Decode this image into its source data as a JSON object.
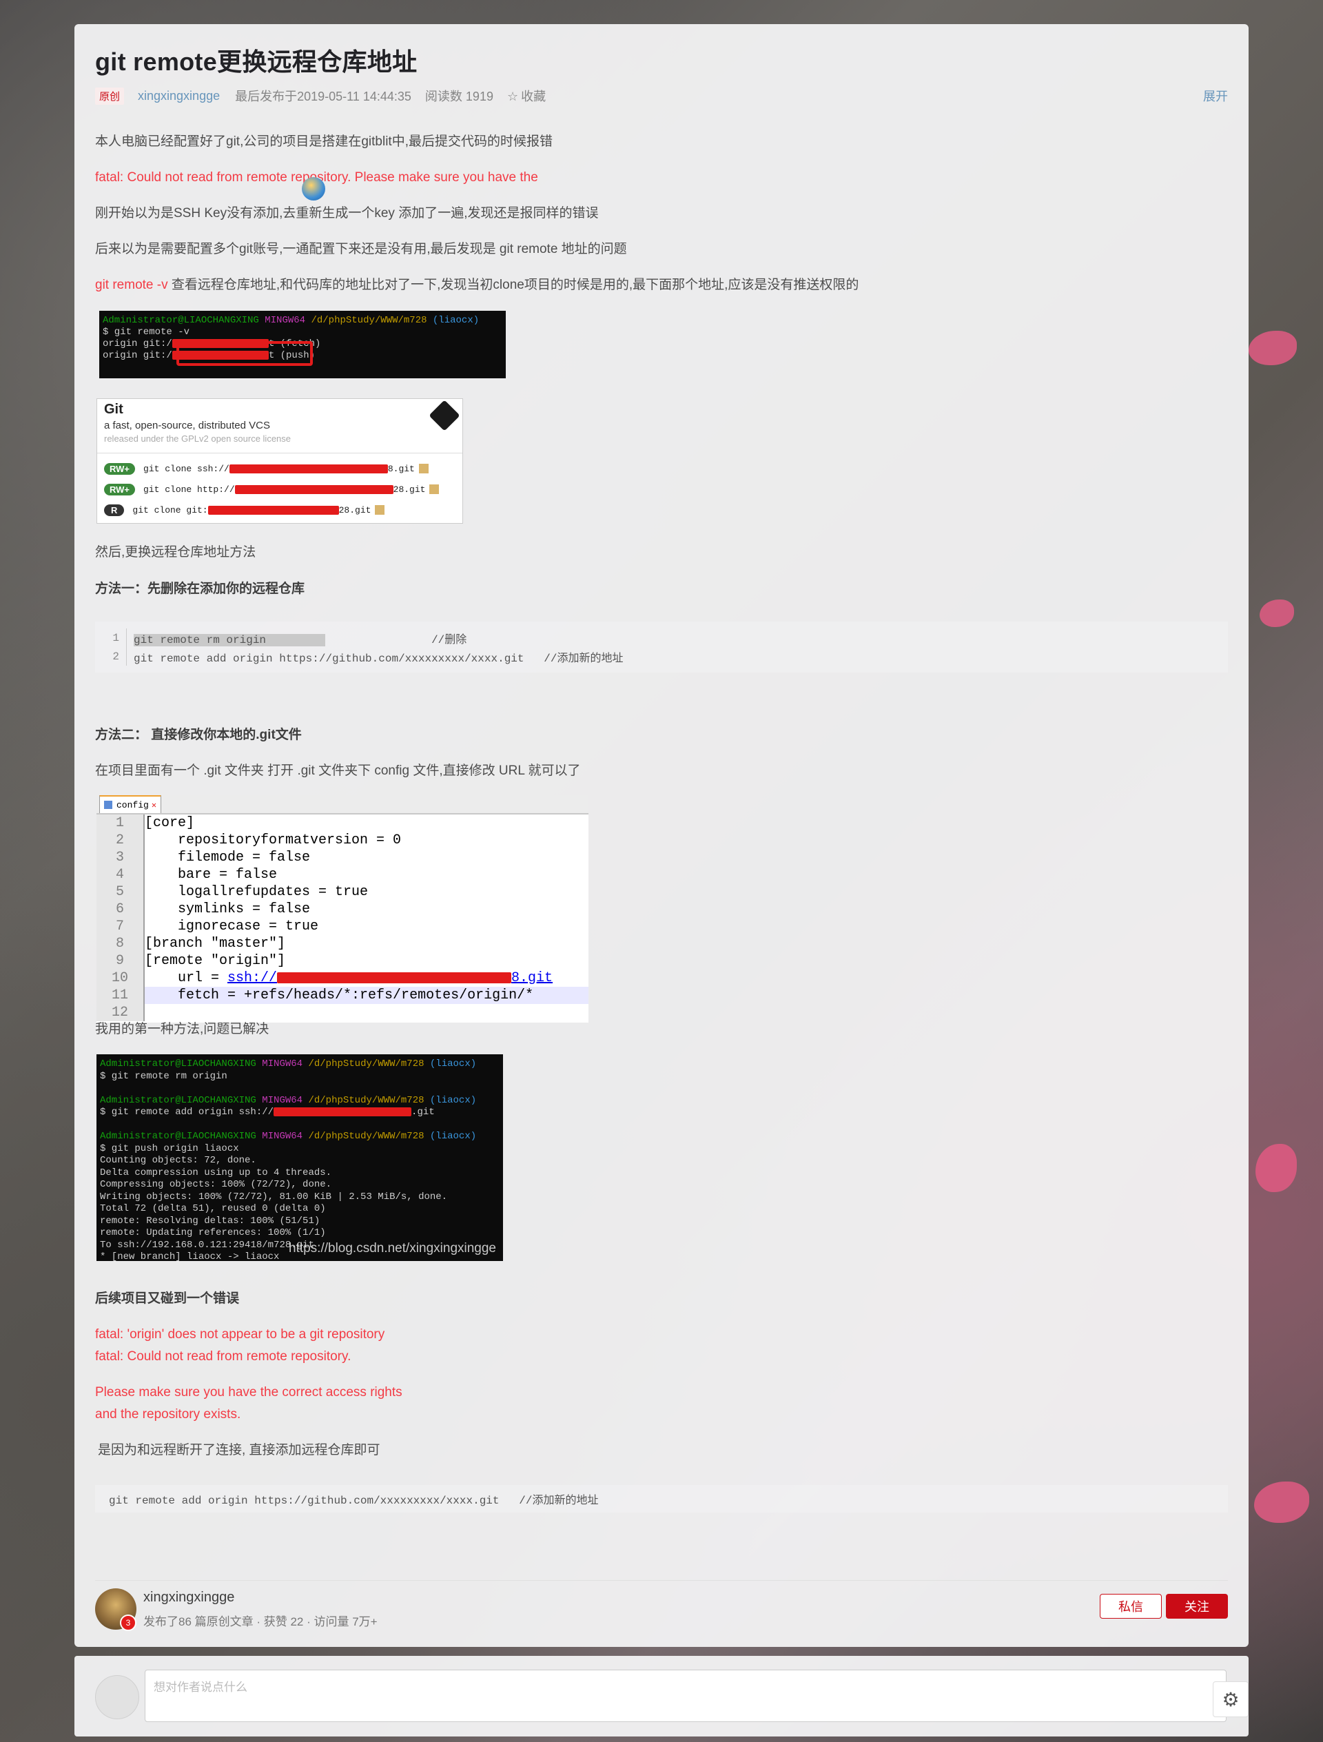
{
  "article": {
    "title": "git remote更换远程仓库地址",
    "tag": "原创",
    "author": "xingxingxingge",
    "published": "最后发布于2019-05-11 14:44:35",
    "reads": "阅读数 1919",
    "collect": "收藏",
    "expand": "展开"
  },
  "body": {
    "p1": "本人电脑已经配置好了git,公司的项目是搭建在gitblit中,最后提交代码的时候报错",
    "p2": "fatal: Could not read from remote repository. Please make sure you have the",
    "p3": "刚开始以为是SSH Key没有添加,去重新生成一个key 添加了一遍,发现还是报同样的错误",
    "p4": "后来以为是需要配置多个git账号,一通配置下来还是没有用,最后发现是 git remote 地址的问题",
    "p5_red": "git remote -v",
    "p5_rest": " 查看远程仓库地址,和代码库的地址比对了一下,发现当初clone项目的时候是用的,最下面那个地址,应该是没有推送权限的",
    "p6": "然后,更换远程仓库地址方法",
    "h1": "方法一：先删除在添加你的远程仓库",
    "h2": "方法二： 直接修改你本地的.git文件",
    "p7": "在项目里面有一个 .git 文件夹 打开 .git 文件夹下 config 文件,直接修改 URL 就可以了",
    "p8": "我用的第一种方法,问题已解决",
    "h3": "后续项目又碰到一个错误",
    "err1": "fatal: 'origin' does not appear to be a git repository",
    "err2": "fatal: Could not read from remote repository.",
    "err3": "Please make sure you have the correct access rights",
    "err4": "and the repository exists.",
    "p9": "是因为和远程断开了连接, 直接添加远程仓库即可"
  },
  "terminal1": {
    "prompt_user": "Administrator@LIAOCHANGXING",
    "prompt_env": "MINGW64",
    "prompt_path": "/d/phpStudy/WWW/m728",
    "prompt_branch": "(liaocx)",
    "cmd": "$ git remote -v",
    "l1a": "origin  git:/",
    "l1b": "t (fetch)",
    "l2a": "origin  git:/",
    "l2b": "t (push)"
  },
  "gitblit": {
    "title": "Git",
    "subtitle": "a fast, open-source, distributed VCS",
    "license": "released under the GPLv2 open source license",
    "rows": [
      {
        "badge": "RW+",
        "prefix": "git clone ssh://",
        "suffix": "8.git"
      },
      {
        "badge": "RW+",
        "prefix": "git clone http://",
        "suffix": "28.git"
      },
      {
        "badge": "R",
        "prefix": "git clone git:",
        "suffix": "28.git"
      }
    ]
  },
  "code1": {
    "lines": [
      {
        "n": "1",
        "text": "git remote rm origin",
        "comment": "                //删除"
      },
      {
        "n": "2",
        "text": "git remote add origin https://github.com/xxxxxxxxx/xxxx.git",
        "comment": "   //添加新的地址"
      }
    ]
  },
  "editor": {
    "tab": "config",
    "lines": [
      {
        "n": "1",
        "t": "[core]"
      },
      {
        "n": "2",
        "t": "    repositoryformatversion = 0"
      },
      {
        "n": "3",
        "t": "    filemode = false"
      },
      {
        "n": "4",
        "t": "    bare = false"
      },
      {
        "n": "5",
        "t": "    logallrefupdates = true"
      },
      {
        "n": "6",
        "t": "    symlinks = false"
      },
      {
        "n": "7",
        "t": "    ignorecase = true"
      },
      {
        "n": "8",
        "t": "[branch \"master\"]"
      },
      {
        "n": "9",
        "t": "[remote \"origin\"]"
      },
      {
        "n": "10",
        "t": "    url = ",
        "link": "ssh://",
        "tail": "8.git"
      },
      {
        "n": "11",
        "t": "    fetch = +refs/heads/*:refs/remotes/origin/*"
      },
      {
        "n": "12",
        "t": ""
      }
    ]
  },
  "terminal2": {
    "lines": [
      "$ git remote rm origin",
      "$ git remote add origin ssh://",
      ".git",
      "$ git push origin liaocx",
      "Counting objects: 72, done.",
      "Delta compression using up to 4 threads.",
      "Compressing objects: 100% (72/72), done.",
      "Writing objects: 100% (72/72), 81.00 KiB | 2.53 MiB/s, done.",
      "Total 72 (delta 51), reused 0 (delta 0)",
      "remote: Resolving deltas: 100% (51/51)",
      "remote: Updating references: 100% (1/1)",
      "To ssh://192.168.0.121:29418/m728.git",
      " * [new branch]      liaocx -> liaocx"
    ],
    "watermark": "https://blog.csdn.net/xingxingxingge"
  },
  "code2": {
    "text": "git remote add origin https://github.com/xxxxxxxxx/xxxx.git   //添加新的地址"
  },
  "author_card": {
    "name": "xingxingxingge",
    "stats": "发布了86 篇原创文章 · 获赞 22 · 访问量 7万+",
    "badge": "3",
    "message_btn": "私信",
    "follow_btn": "关注"
  },
  "comment": {
    "placeholder": "想对作者说点什么"
  }
}
